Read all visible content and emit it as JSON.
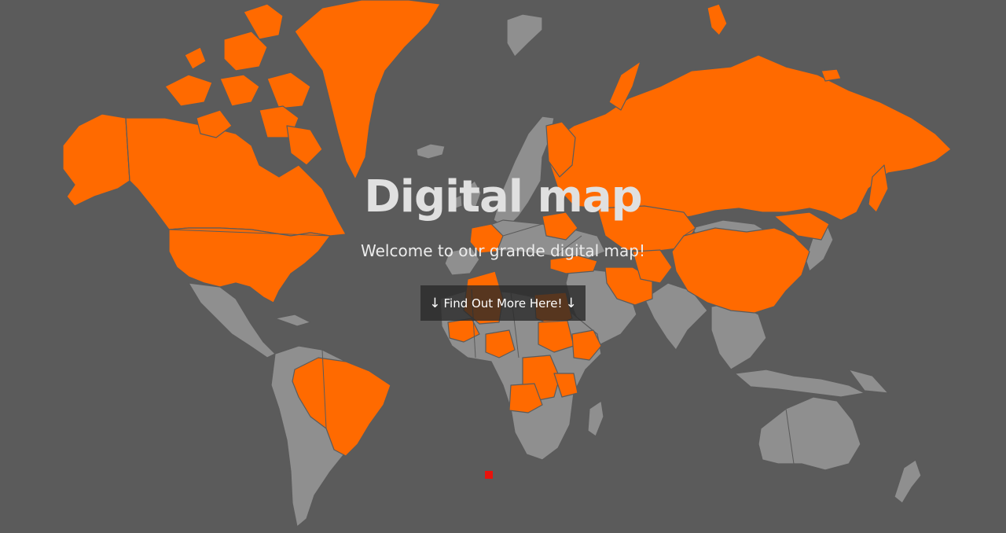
{
  "colors": {
    "ocean": "#5b5b5b",
    "highlighted_country": "#ff6a00",
    "other_country": "#8f8f8f",
    "marker": "#e8120c",
    "button_background": "#2c2c2c"
  },
  "hero": {
    "title": "Digital map",
    "subtitle": "Welcome to our grande digital map!",
    "button": {
      "arrow_left": "↓",
      "label": "Find Out More Here!",
      "arrow_right": "↓"
    }
  },
  "map": {
    "projection": "world map, countries shaded",
    "highlighted_regions": [
      "Canada",
      "United States",
      "Greenland",
      "Brazil",
      "Russia",
      "China",
      "Mongolia region",
      "Kazakhstan",
      "Afghanistan",
      "Pakistan",
      "Iran",
      "Turkey",
      "France",
      "Finland",
      "Algeria",
      "Egypt",
      "Sudan",
      "Ethiopia",
      "Nigeria",
      "DR Congo",
      "Angola",
      "Tanzania"
    ],
    "marker_icon": "red-square-marker"
  }
}
